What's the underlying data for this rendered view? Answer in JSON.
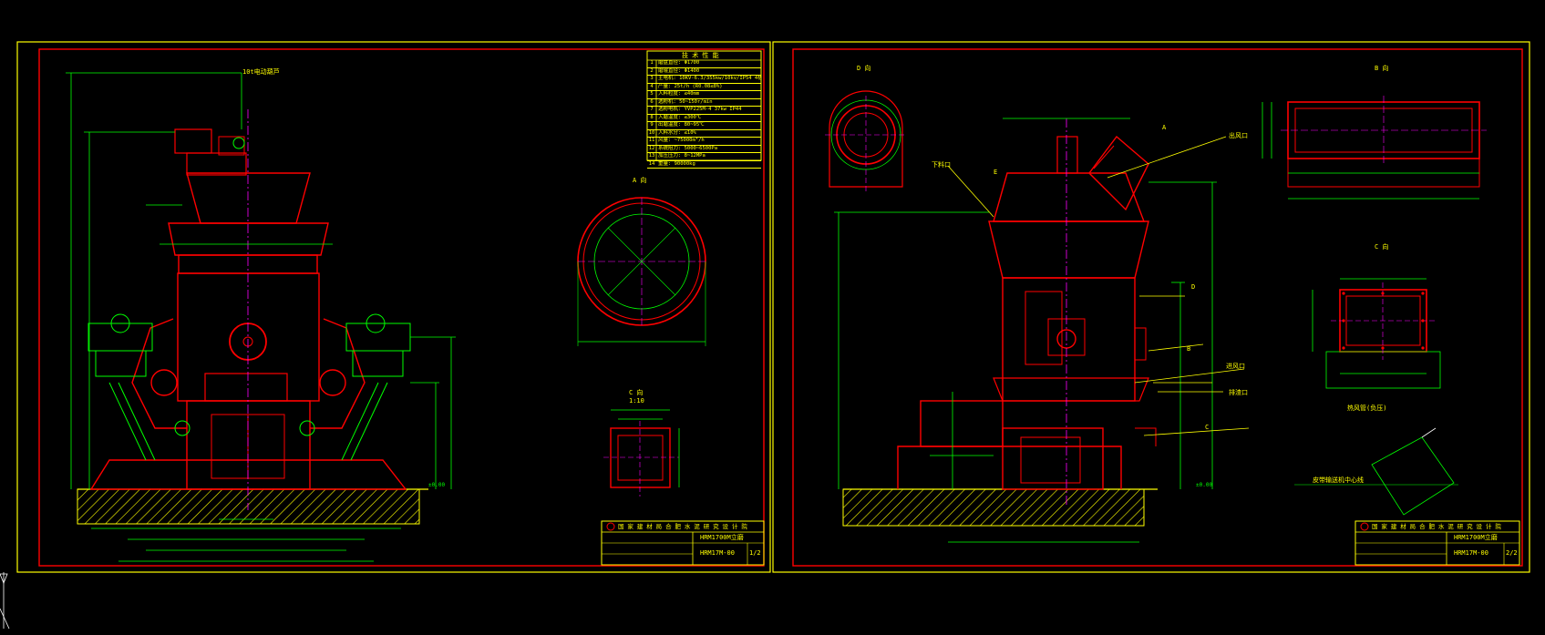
{
  "left_sheet": {
    "title_note": "10t电动葫芦",
    "section_a": "A 向",
    "section_c": "C 向",
    "scale_c": "1:10",
    "spec_table": {
      "header": "技 术 性 能",
      "rows": [
        [
          "1",
          "磨盘直径: Φ1700"
        ],
        [
          "2",
          "磨辊直径: Φ1400"
        ],
        [
          "3",
          "主电机: 10KV-6.3/355kw/10kv/IP54 4极"
        ],
        [
          "4",
          "产量: 25t/h (R0.08≤8%)"
        ],
        [
          "5",
          "入料粒度: ≤40mm"
        ],
        [
          "6",
          "选粉机: 50~150r/min"
        ],
        [
          "7",
          "选粉电机: YVP225M-4 37kw IP44"
        ],
        [
          "8",
          "入磨温度: ≤300℃"
        ],
        [
          "9",
          "出磨温度: 80~95℃"
        ],
        [
          "10",
          "入料水分: ≤10%"
        ],
        [
          "11",
          "风量: ~75000m³/h"
        ],
        [
          "12",
          "系统阻力: 5000~6500Pa"
        ],
        [
          "13",
          "加压压力: 8~12MPa"
        ],
        [
          "14",
          "重量: 90000kg"
        ]
      ]
    },
    "title_block": {
      "company": "国 家 建 材 局 合 肥 水 泥 研 究 设 计 院",
      "name": "HRM1700M立磨",
      "number": "HRM17M-00",
      "sheet": "1/2"
    },
    "levels": {
      "ground": "±0.00"
    }
  },
  "right_sheet": {
    "label_a": "A",
    "label_b": "B",
    "label_c": "C",
    "label_d": "D",
    "label_e": "E",
    "view_d": "D 向",
    "view_b": "B 向",
    "view_c": "C 向",
    "note_outlet": "出风口",
    "note_inlet": "进风口",
    "note_slag": "排渣口",
    "note_feed": "下料口",
    "note_conveyor": "皮带输送机中心线",
    "note_duct": "热风管(负压)",
    "title_block": {
      "company": "国 家 建 材 局 合 肥 水 泥 研 究 设 计 院",
      "name": "HRM1700M立磨",
      "number": "HRM17M-00",
      "sheet": "2/2"
    },
    "levels": {
      "ground": "±0.00"
    }
  },
  "colors": {
    "background": "#000000",
    "frame": "#ffff00",
    "border": "#ff0000",
    "dimension": "#00ff00",
    "centerline": "#ff00ff",
    "text": "#ffffff"
  }
}
